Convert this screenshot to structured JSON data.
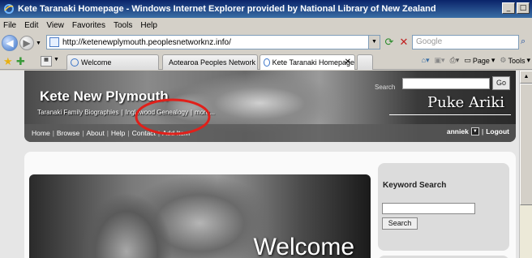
{
  "window": {
    "title": "Kete Taranaki Homepage - Windows Internet Explorer provided by National Library of New Zealand",
    "buttons": [
      "_",
      "□"
    ]
  },
  "menu": [
    "File",
    "Edit",
    "View",
    "Favorites",
    "Tools",
    "Help"
  ],
  "address": {
    "url": "http://ketenewplymouth.peoplesnetworknz.info/",
    "search_placeholder": "Google"
  },
  "tabs": [
    {
      "label": "Welcome",
      "active": false
    },
    {
      "label": "Aotearoa Peoples Network K...",
      "active": false
    },
    {
      "label": "Kete Taranaki Homepage",
      "active": true
    }
  ],
  "command_bar": {
    "page_label": "Page",
    "tools_label": "Tools"
  },
  "site": {
    "title": "Kete New Plymouth",
    "subtitle_links": [
      "Taranaki Family Biographies",
      "|",
      "Inglewood Genealogy",
      "|",
      "more..."
    ],
    "logo_text": "Puke Ariki",
    "search_label": "Search",
    "go_label": "Go",
    "nav": [
      "Home",
      "Browse",
      "About",
      "Help",
      "Contact",
      "Add Item"
    ],
    "user": "anniek",
    "logout": "Logout"
  },
  "hero": {
    "welcome": "Welcome"
  },
  "sidebar": {
    "keyword_title": "Keyword Search",
    "search_button": "Search"
  },
  "colors": {
    "annotation": "#e0201a",
    "titlebar": "#0a246a"
  }
}
